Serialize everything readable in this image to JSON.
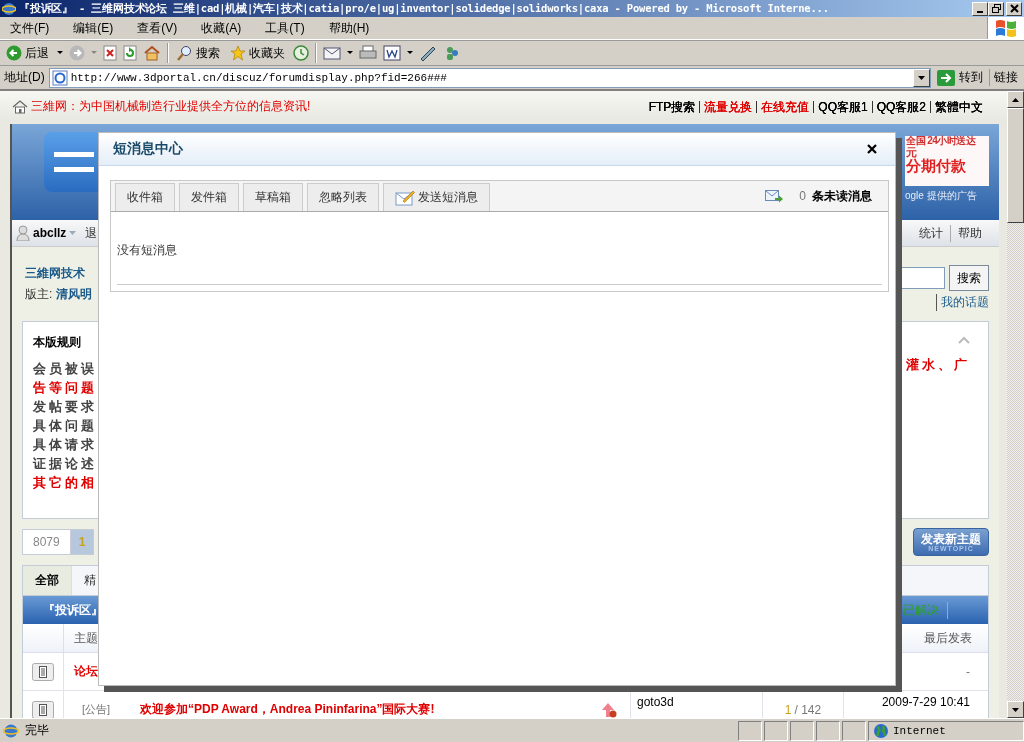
{
  "window": {
    "title": "『投诉区』 - 三维网技术论坛 三维|cad|机械|汽车|技术|catia|pro/e|ug|inventor|solidedge|solidworks|caxa - Powered by  - Microsoft Interne..."
  },
  "menu": [
    "文件(F)",
    "编辑(E)",
    "查看(V)",
    "收藏(A)",
    "工具(T)",
    "帮助(H)"
  ],
  "toolbar": {
    "back": "后退",
    "search": "搜索",
    "favorites": "收藏夹"
  },
  "address_bar": {
    "label": "地址(D)",
    "url": "http://www.3dportal.cn/discuz/forumdisplay.php?fid=266###",
    "go": "转到",
    "links": "链接"
  },
  "page": {
    "top_notice": "三維网：为中国机械制造行业提供全方位的信息资讯!",
    "top_links": [
      {
        "label": "FTP搜索",
        "color": "#000000"
      },
      {
        "label": "流量兑换",
        "color": "#e00000"
      },
      {
        "label": "在线充值",
        "color": "#e00000"
      },
      {
        "label": "QQ客服1",
        "color": "#000000"
      },
      {
        "label": "QQ客服2",
        "color": "#000000"
      },
      {
        "label": "繁體中文",
        "color": "#000000"
      }
    ],
    "ad": {
      "line_1": "全国 24小时送达",
      "line_2": "元",
      "line_3": "分期付款",
      "caption": "ogle 提供的广告"
    },
    "user_bar": {
      "username": "abcllz",
      "logout": "退",
      "links": [
        "统计",
        "帮助"
      ]
    },
    "forum": {
      "name": "三維网技术",
      "moderators_label": "版主:",
      "moderator": "清风明",
      "search_button": "搜索",
      "links": [
        "我的话题"
      ]
    },
    "rules": {
      "title": "本版规则",
      "lines": [
        {
          "text": "会员被误",
          "color": "#444444"
        },
        {
          "text": "告等问题",
          "color": "#e00000"
        },
        {
          "text": "发帖要求",
          "color": "#444444"
        },
        {
          "text": "具体问题",
          "color": "#444444"
        },
        {
          "text": "具体请求",
          "color": "#444444"
        },
        {
          "text": "证据论述",
          "color": "#444444"
        },
        {
          "text": "其它的相",
          "color": "#e00000"
        }
      ],
      "tail": "灌水、广"
    },
    "pagination": {
      "total": "8079",
      "pages": [
        {
          "label": "1",
          "selected": true
        }
      ]
    },
    "new_topic_button": {
      "label": "发表新主题",
      "sublabel": "NEWTOPIC"
    },
    "filter_tabs": [
      {
        "label": "全部",
        "selected": true
      },
      {
        "label": "精",
        "selected": false
      }
    ],
    "forum_header": {
      "title": "『投诉区』",
      "filter": "已解决"
    },
    "columns": [
      "主题",
      "最后发表"
    ],
    "threads": [
      {
        "title": "论坛",
        "last_post": "-"
      },
      {
        "tag": "[公告]",
        "title": "欢迎参加“PDP Award，Andrea Pininfarina”国际大赛!",
        "author": "goto3d",
        "reply_count": "1",
        "view_count": "/ 142",
        "last_post": "2009-7-29 10:41"
      }
    ]
  },
  "dialog": {
    "title": "短消息中心",
    "tabs": [
      {
        "label": "收件箱",
        "kind": "plain",
        "selected": false
      },
      {
        "label": "发件箱",
        "kind": "plain",
        "selected": false
      },
      {
        "label": "草稿箱",
        "kind": "plain",
        "selected": false
      },
      {
        "label": "忽略列表",
        "kind": "plain",
        "selected": false
      },
      {
        "label": "发送短消息",
        "kind": "compose",
        "selected": false
      }
    ],
    "unread_count": "0",
    "unread_label": "条未读消息",
    "empty_text": "没有短消息"
  },
  "status_bar": {
    "text": "完毕",
    "zone": "Internet"
  }
}
